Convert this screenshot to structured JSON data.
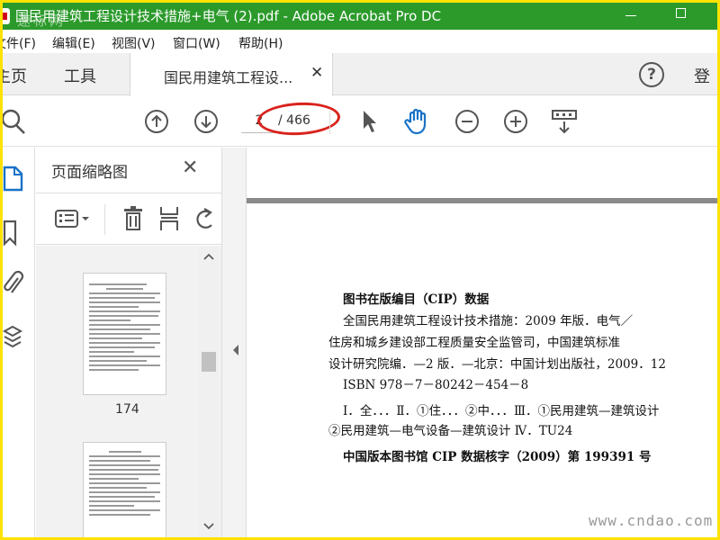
{
  "window": {
    "title": "国民用建筑工程设计技术措施+电气 (2).pdf - Adobe Acrobat Pro DC",
    "watermark": "速标网",
    "accent": "#2b9a2b"
  },
  "menu": [
    "文件(F)",
    "编辑(E)",
    "视图(V)",
    "窗口(W)",
    "帮助(H)"
  ],
  "tabs": {
    "home": "主页",
    "tools": "工具",
    "document": "国民用建筑工程设...",
    "login": "登"
  },
  "toolbar": {
    "current_page": "2",
    "total_pages": "/ 466",
    "highlight_color": "#d9231d"
  },
  "sidebar": {
    "title": "页面缩略图",
    "page_label": "174"
  },
  "document": {
    "lines": [
      "图书在版编目（CIP）数据",
      "全国民用建筑工程设计技术措施：2009 年版．电气／",
      "住房和城乡建设部工程质量安全监管司，中国建筑标准",
      "设计研究院编．—2 版．—北京：中国计划出版社，2009．12",
      "ISBN 978－7－80242－454－8",
      "Ⅰ．全．．．Ⅱ．①住．．．②中．．．Ⅲ．①民用建筑—建筑设计",
      "②民用建筑—电气设备—建筑设计 Ⅳ．TU24",
      "中国版本图书馆 CIP 数据核字（2009）第 199391 号"
    ],
    "site_watermark": "www.cndao.com"
  }
}
